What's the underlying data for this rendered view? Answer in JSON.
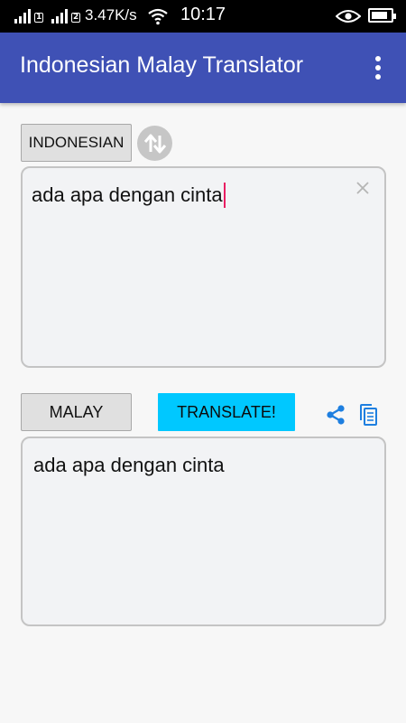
{
  "status_bar": {
    "sim1": "1",
    "sim2": "2",
    "network_speed": "3.47K/s",
    "time": "10:17",
    "battery_level": 0.85
  },
  "app_bar": {
    "title": "Indonesian Malay Translator",
    "menu_icon": "overflow-menu-icon"
  },
  "source": {
    "language_label": "INDONESIAN",
    "text": "ada apa dengan cinta",
    "swap_icon": "swap-arrows-icon",
    "clear_icon": "close-icon"
  },
  "target": {
    "language_label": "MALAY",
    "translate_label": "TRANSLATE!",
    "result_text": "ada apa dengan cinta",
    "share_icon": "share-icon",
    "copy_icon": "copy-icon"
  },
  "colors": {
    "app_bar": "#3f51b5",
    "translate_button": "#00c8ff",
    "action_icons": "#1e7fe0",
    "cursor": "#e91e63"
  }
}
